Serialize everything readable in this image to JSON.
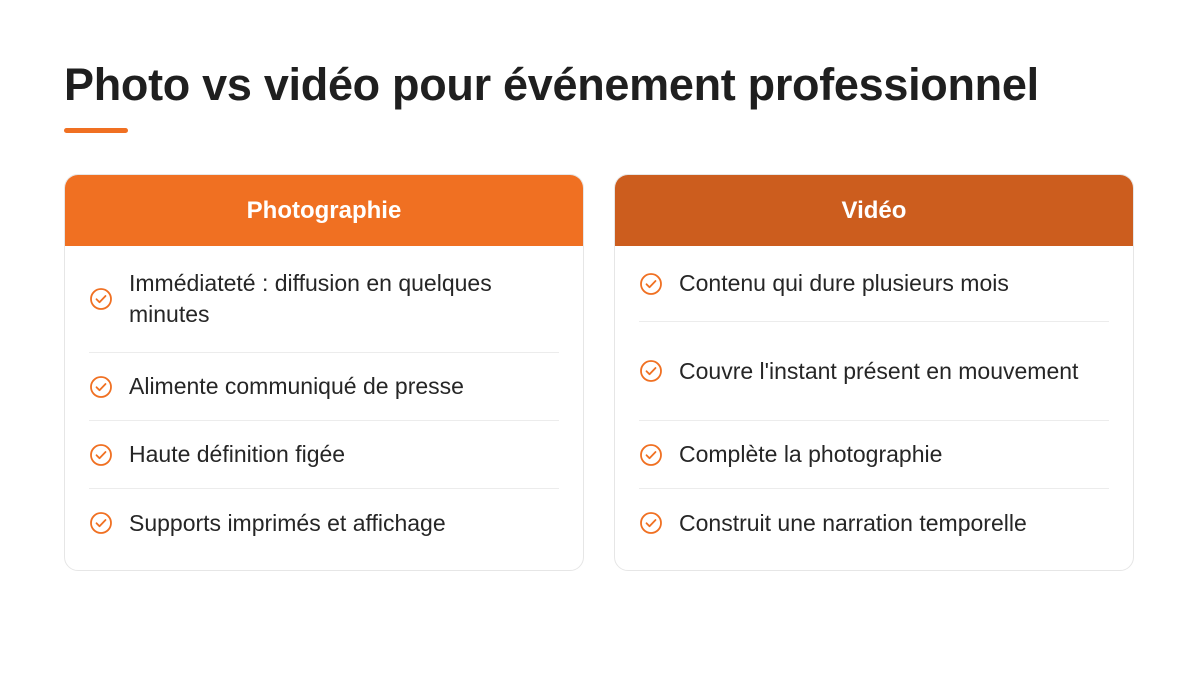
{
  "page": {
    "title": "Photo vs vidéo pour événement professionnel",
    "accent_color": "#f07022"
  },
  "cards": [
    {
      "header": "Photographie",
      "header_color": "#f07022",
      "items": [
        "Immédiateté : diffusion en quelques minutes",
        "Alimente communiqué de presse",
        "Haute définition figée",
        "Supports imprimés et affichage"
      ]
    },
    {
      "header": "Vidéo",
      "header_color": "#cc5d1e",
      "items": [
        "Contenu qui dure plusieurs mois",
        "Couvre l'instant présent en mouvement",
        "Complète la photographie",
        "Construit une narration temporelle"
      ]
    }
  ],
  "icons": {
    "item_icon": "check-circle-icon"
  }
}
